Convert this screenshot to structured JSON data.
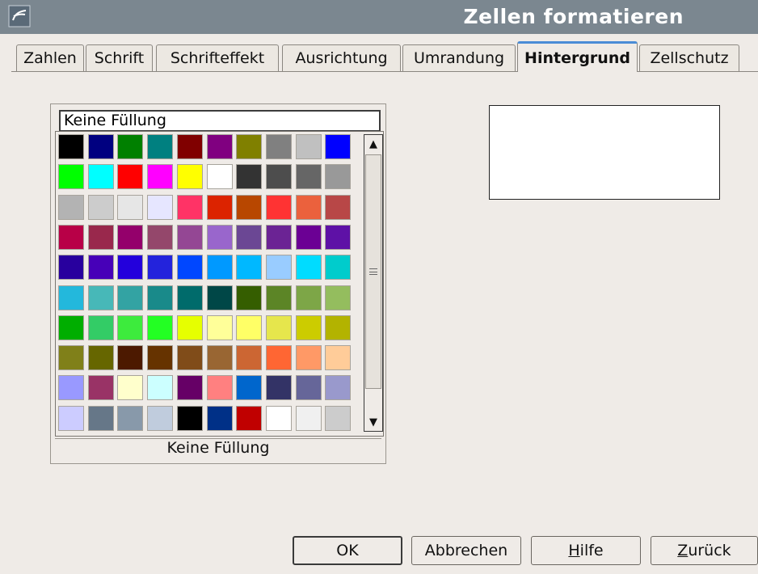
{
  "window": {
    "title": "Zellen formatieren",
    "app_icon": "office-document-icon"
  },
  "tabs": [
    {
      "label": "Zahlen",
      "active": false
    },
    {
      "label": "Schrift",
      "active": false
    },
    {
      "label": "Schrifteffekt",
      "active": false
    },
    {
      "label": "Ausrichtung",
      "active": false
    },
    {
      "label": "Umrandung",
      "active": false
    },
    {
      "label": "Hintergrund",
      "active": true
    },
    {
      "label": "Zellschutz",
      "active": false
    }
  ],
  "background": {
    "selected_fill_name": "Keine Füllung",
    "selected_fill_label": "Keine Füllung",
    "preview_color": "#ffffff",
    "palette": [
      [
        "#000000",
        "#000080",
        "#008000",
        "#008080",
        "#800000",
        "#800080",
        "#808000",
        "#808080",
        "#c0c0c0",
        "#0000ff"
      ],
      [
        "#00ff00",
        "#00ffff",
        "#ff0000",
        "#ff00ff",
        "#ffff00",
        "#ffffff",
        "#333333",
        "#4d4d4d",
        "#666666",
        "#999999"
      ],
      [
        "#b3b3b3",
        "#cccccc",
        "#e6e6e6",
        "#e6e6ff",
        "#ff3366",
        "#dc2300",
        "#b84700",
        "#ff3333",
        "#eb613d",
        "#b84747"
      ],
      [
        "#b80047",
        "#99284c",
        "#94006b",
        "#94476b",
        "#944794",
        "#9966cc",
        "#6b4794",
        "#6b2394",
        "#6b0094",
        "#5e11a6"
      ],
      [
        "#28009e",
        "#4700b8",
        "#2300dc",
        "#2323dc",
        "#0047ff",
        "#0099ff",
        "#00b8ff",
        "#99ccff",
        "#00dcff",
        "#00cccc"
      ],
      [
        "#23b8dc",
        "#47b8b8",
        "#33a3a3",
        "#198a8a",
        "#006b6b",
        "#004747",
        "#355e00",
        "#5c8526",
        "#7da647",
        "#94bd5e"
      ],
      [
        "#00ae00",
        "#33cc66",
        "#3deb3d",
        "#23ff23",
        "#e6ff00",
        "#ffff99",
        "#ffff66",
        "#e6e64c",
        "#cccc00",
        "#b3b300"
      ],
      [
        "#808019",
        "#666600",
        "#4c1900",
        "#663300",
        "#804c19",
        "#996633",
        "#cc6633",
        "#ff6633",
        "#ff9966",
        "#ffcc99"
      ],
      [
        "#9999ff",
        "#993366",
        "#ffffcc",
        "#ccffff",
        "#660066",
        "#ff8080",
        "#0066cc",
        "#333366",
        "#666699",
        "#9999cc"
      ],
      [
        "#ccccff",
        "#667788",
        "#8899aa",
        "#c0ccdd",
        "#000000",
        "#003087",
        "#c00000",
        "#ffffff",
        "#f0f0f0",
        "#cccccc"
      ]
    ],
    "scrollbar": {
      "up_icon": "arrow-up-icon",
      "down_icon": "arrow-down-icon",
      "grip_icon": "scroll-grip-icon"
    }
  },
  "buttons": {
    "ok": "OK",
    "cancel": "Abbrechen",
    "help_mnemonic": "H",
    "help_rest": "ilfe",
    "reset_mnemonic": "Z",
    "reset_rest": "urück"
  }
}
